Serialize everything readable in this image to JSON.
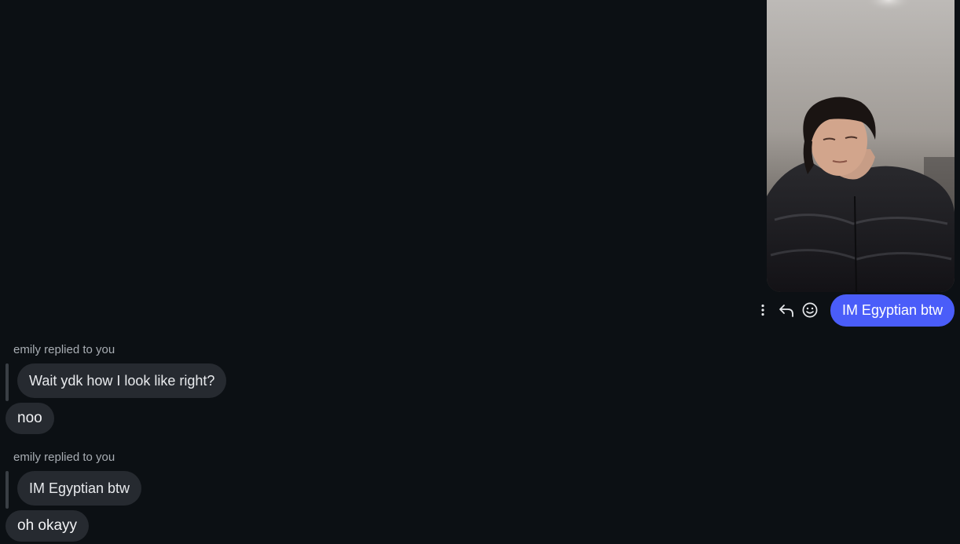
{
  "outgoing": {
    "photo_icon": "selfie-photo",
    "message": "IM Egyptian btw",
    "bubble_color": "#4a5df9",
    "actions": [
      {
        "icon": "more-options-icon"
      },
      {
        "icon": "reply-icon"
      },
      {
        "icon": "emoji-react-icon"
      }
    ]
  },
  "incoming": [
    {
      "reply_caption": "emily replied to you",
      "quoted": "Wait ydk how I look like right?",
      "message": "noo"
    },
    {
      "reply_caption": "emily replied to you",
      "quoted": "IM Egyptian btw",
      "message": "oh okayy"
    }
  ]
}
